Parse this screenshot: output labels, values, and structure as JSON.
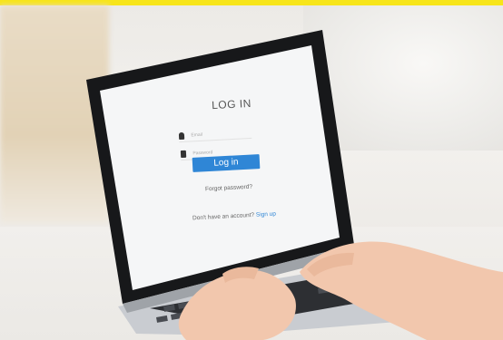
{
  "login": {
    "title": "LOG IN",
    "email_placeholder": "Email",
    "password_placeholder": "Password",
    "login_button": "Log in",
    "forgot_password": "Forgot password?",
    "signup_prompt": "Don't have an account?",
    "signup_link": "Sign up"
  },
  "colors": {
    "top_bar": "#f7e51a",
    "login_button": "#2f86d6",
    "link": "#2f86d6"
  }
}
